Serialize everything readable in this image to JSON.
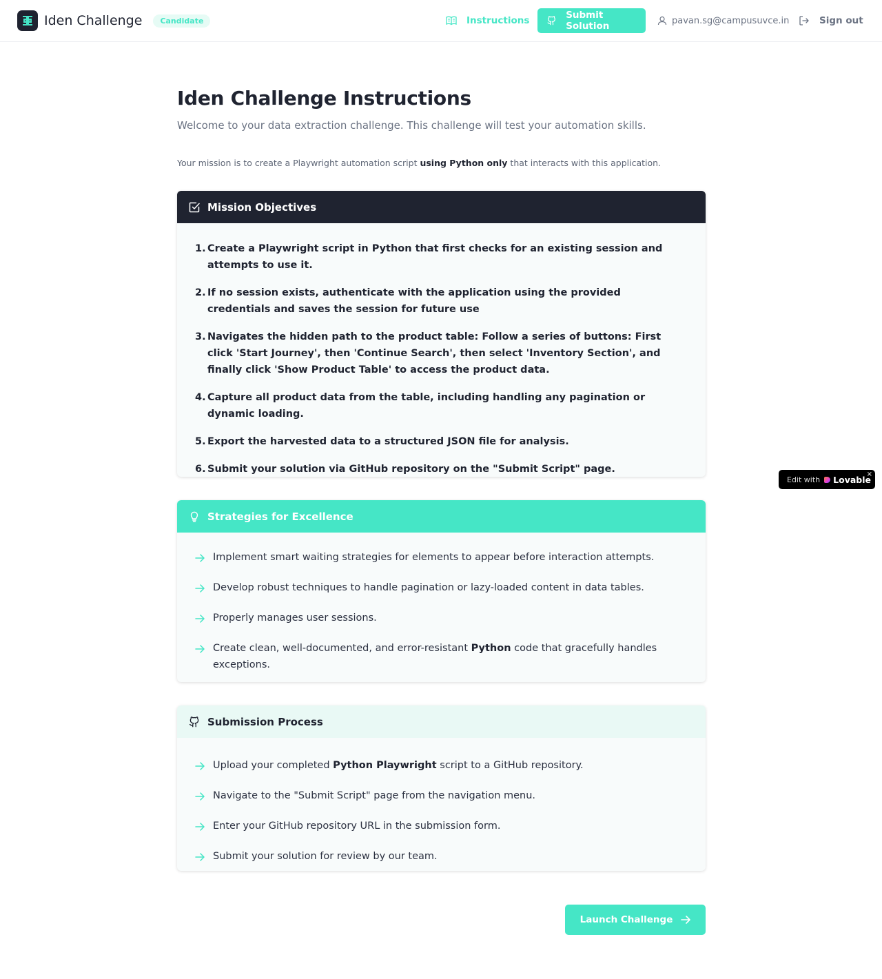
{
  "header": {
    "brand": "Iden Challenge",
    "role_badge": "Candidate",
    "nav": {
      "instructions": "Instructions",
      "submit": "Submit Solution",
      "user_email": "pavan.sg@campusuvce.in",
      "sign_out": "Sign out"
    }
  },
  "page": {
    "title": "Iden Challenge Instructions",
    "subtitle": "Welcome to your data extraction challenge. This challenge will test your automation skills.",
    "mission_prefix": "Your mission is to create a Playwright automation script ",
    "mission_bold": "using Python only",
    "mission_suffix": " that interacts with this application."
  },
  "objectives": {
    "title": "Mission Objectives",
    "items": [
      {
        "num": "1.",
        "text": "Create a Playwright script in Python that first checks for an existing session and attempts to use it."
      },
      {
        "num": "2.",
        "text": "If no session exists, authenticate with the application using the provided credentials and saves the session for future use"
      },
      {
        "num": "3.",
        "text": "Navigates the hidden path to the product table: Follow a series of buttons: First click 'Start Journey', then 'Continue Search', then select 'Inventory Section', and finally click 'Show Product Table' to access the product data."
      },
      {
        "num": "4.",
        "text": "Capture all product data from the table, including handling any pagination or dynamic loading."
      },
      {
        "num": "5.",
        "text": "Export the harvested data to a structured JSON file for analysis."
      },
      {
        "num": "6.",
        "text": "Submit your solution via GitHub repository on the \"Submit Script\" page."
      }
    ]
  },
  "strategies": {
    "title": "Strategies for Excellence",
    "items": [
      {
        "pre": "Implement smart waiting strategies for elements to appear before interaction attempts.",
        "bold": "",
        "post": ""
      },
      {
        "pre": "Develop robust techniques to handle pagination or lazy-loaded content in data tables.",
        "bold": "",
        "post": ""
      },
      {
        "pre": "Properly manages user sessions.",
        "bold": "",
        "post": ""
      },
      {
        "pre": "Create clean, well-documented, and error-resistant ",
        "bold": "Python",
        "post": " code that gracefully handles exceptions."
      }
    ]
  },
  "submission": {
    "title": "Submission Process",
    "items": [
      {
        "pre": "Upload your completed ",
        "bold": "Python Playwright",
        "post": " script to a GitHub repository."
      },
      {
        "pre": "Navigate to the \"Submit Script\" page from the navigation menu.",
        "bold": "",
        "post": ""
      },
      {
        "pre": "Enter your GitHub repository URL in the submission form.",
        "bold": "",
        "post": ""
      },
      {
        "pre": "Submit your solution for review by our team.",
        "bold": "",
        "post": ""
      }
    ]
  },
  "launch_label": "Launch Challenge",
  "lovable": {
    "edit": "Edit with",
    "word": "Lovable",
    "close": "×"
  },
  "colors": {
    "accent": "#45e6c6",
    "dark": "#1f2330",
    "muted": "#6b7383"
  }
}
